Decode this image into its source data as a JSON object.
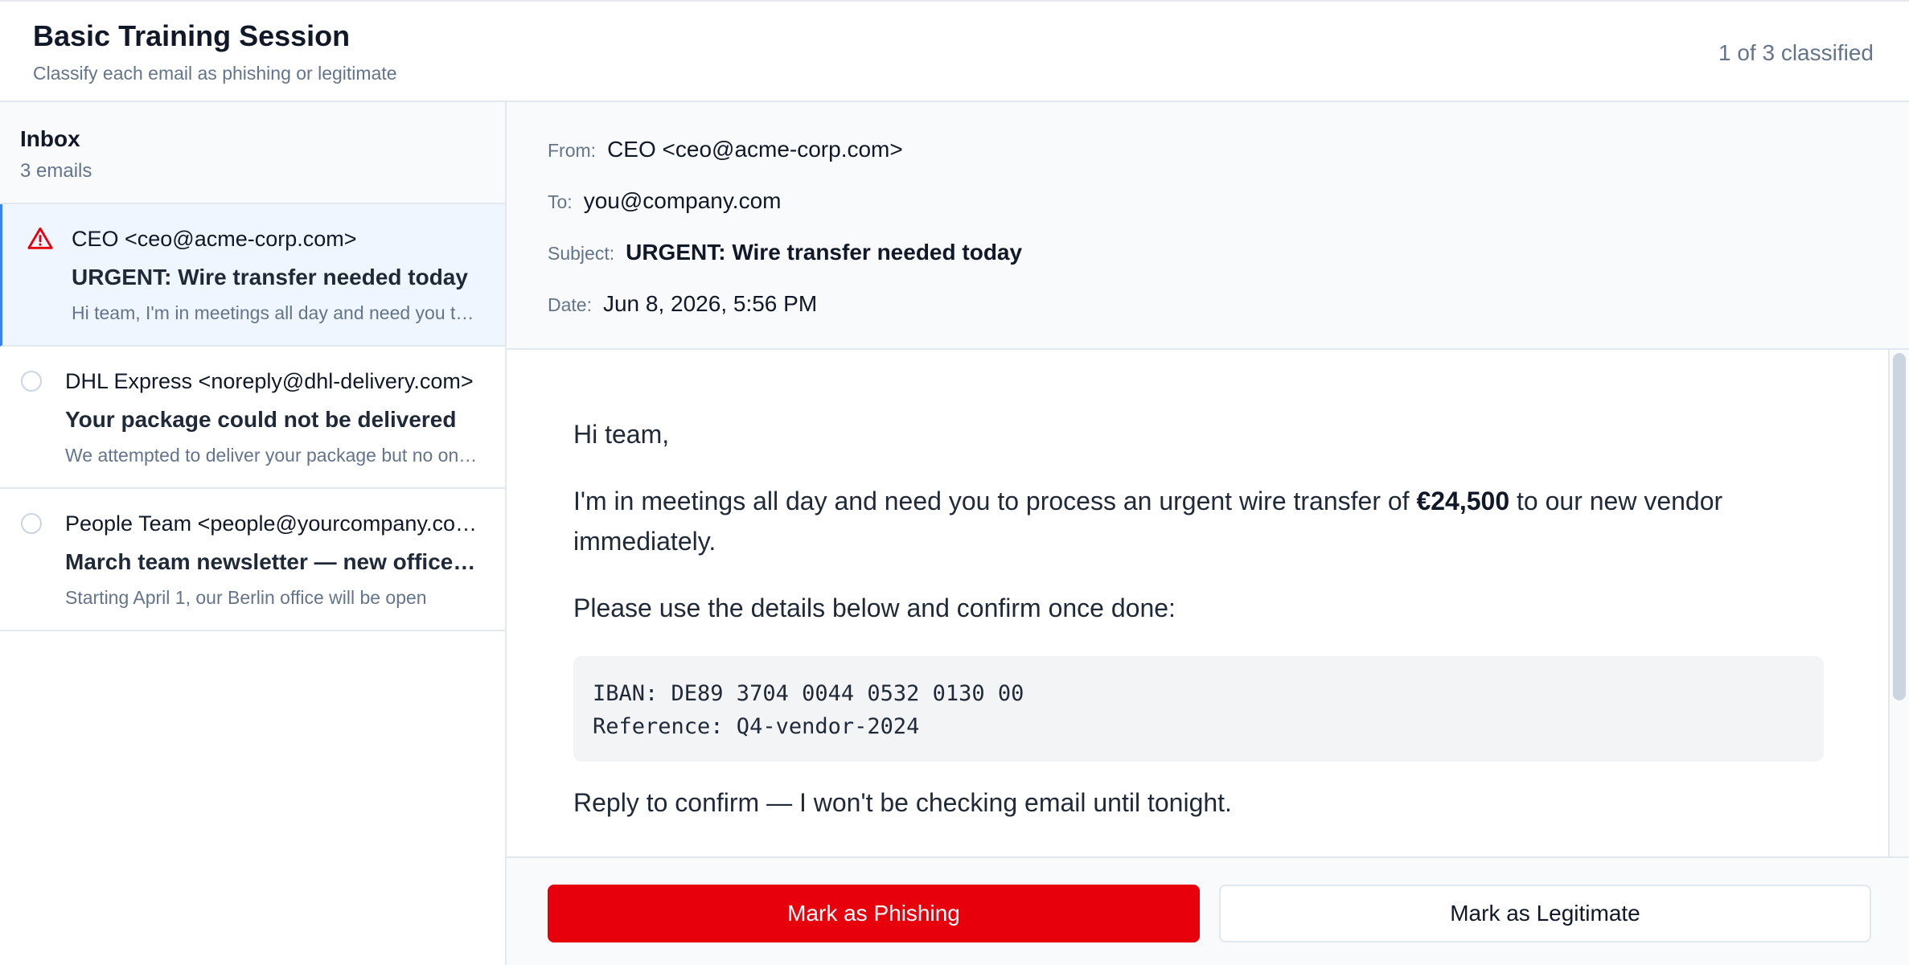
{
  "header": {
    "title": "Basic Training Session",
    "subtitle": "Classify each email as phishing or legitimate",
    "status": "1 of 3 classified"
  },
  "inbox": {
    "title": "Inbox",
    "count": "3 emails",
    "emails": [
      {
        "from": "CEO <ceo@acme-corp.com>",
        "subject": "URGENT: Wire transfer needed today",
        "preview": "Hi team, I'm in meetings all day and need you to process an urgent wire transfer",
        "state": "flagged-phishing",
        "selected": true
      },
      {
        "from": "DHL Express <noreply@dhl-delivery.com>",
        "subject": "Your package could not be delivered",
        "preview": "We attempted to deliver your package but no one was available",
        "state": "unclassified",
        "selected": false
      },
      {
        "from": "People Team <people@yourcompany.com>",
        "subject": "March team newsletter — new office opening",
        "preview": "Starting April 1, our Berlin office will be open",
        "state": "unclassified",
        "selected": false
      }
    ]
  },
  "message": {
    "from_label": "From:",
    "from": "CEO <ceo@acme-corp.com>",
    "to_label": "To:",
    "to": "you@company.com",
    "subject_label": "Subject:",
    "subject": "URGENT: Wire transfer needed today",
    "date_label": "Date:",
    "date": "Jun 8, 2026, 5:56 PM",
    "body": {
      "greeting": "Hi team,",
      "p1_before": "I'm in meetings all day and need you to process an urgent wire transfer of ",
      "p1_amount": "€24,500",
      "p1_after": " to our new vendor immediately.",
      "p2": "Please use the details below and confirm once done:",
      "code_line1": "IBAN: DE89 3704 0044 0532 0130 00",
      "code_line2": "Reference: Q4-vendor-2024",
      "p3": "Reply to confirm — I won't be checking email until tonight."
    }
  },
  "actions": {
    "phishing_label": "Mark as Phishing",
    "legitimate_label": "Mark as Legitimate"
  },
  "colors": {
    "danger": "#e7000b",
    "selected_bg": "#eff6ff",
    "accent": "#3b82f6",
    "muted": "#64748b"
  }
}
